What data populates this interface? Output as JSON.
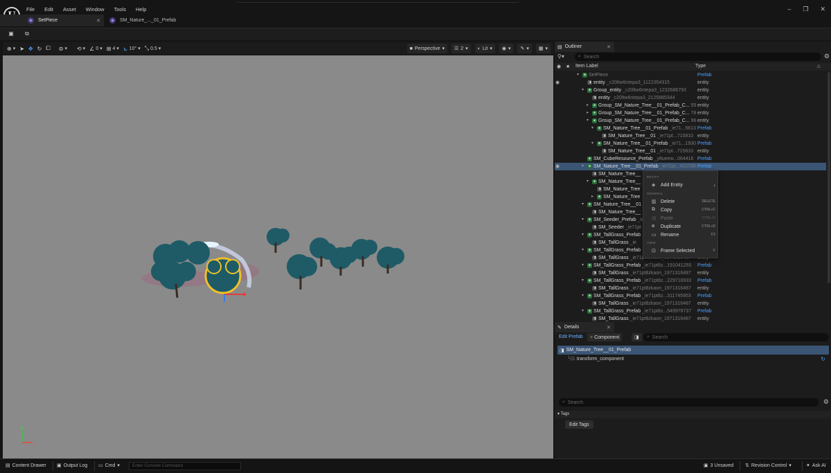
{
  "menu": [
    "File",
    "Edit",
    "Asset",
    "Window",
    "Tools",
    "Help"
  ],
  "tabs": [
    {
      "label": "SetPiece",
      "active": true
    },
    {
      "label": "SM_Nature_..._01_Prefab",
      "active": false
    }
  ],
  "viewport": {
    "num1": "0",
    "num2": "4",
    "angle": "10°",
    "scale": "0.5",
    "perspective": "Perspective",
    "cams": "2",
    "lit": "Lit",
    "axis_up": "U",
    "axis_right": "L"
  },
  "outliner": {
    "title": "Outliner",
    "search_placeholder": "Search",
    "col_label": "Item Label",
    "col_type": "Type",
    "rows": [
      {
        "indent": 0,
        "arrow": "▾",
        "icon": "prefab",
        "label": "SetPiece",
        "sub": "",
        "type": "Prefab",
        "dim": true,
        "eye": false
      },
      {
        "indent": 1,
        "arrow": "",
        "icon": "entity",
        "label": "entity",
        "sub": "_c20ltw6ntepa3_1122354315",
        "type": "entity",
        "eye": true
      },
      {
        "indent": 1,
        "arrow": "▾",
        "icon": "prefab",
        "label": "Group_entity",
        "sub": "_c20ltw6ntepa3_1232686793",
        "type": "entity"
      },
      {
        "indent": 2,
        "arrow": "",
        "icon": "entity",
        "label": "entity",
        "sub": "_c20ltw6ntepa3_2125885344",
        "type": "entity"
      },
      {
        "indent": 2,
        "arrow": "▸",
        "icon": "prefab",
        "label": "Group_SM_Nature_Tree__01_Prefab_C...",
        "sub": "55",
        "type": "entity"
      },
      {
        "indent": 2,
        "arrow": "▸",
        "icon": "prefab",
        "label": "Group_SM_Nature_Tree__01_Prefab_C...",
        "sub": "78",
        "type": "entity"
      },
      {
        "indent": 2,
        "arrow": "▾",
        "icon": "prefab",
        "label": "Group_SM_Nature_Tree__01_Prefab_C...",
        "sub": "96",
        "type": "entity"
      },
      {
        "indent": 3,
        "arrow": "▾",
        "icon": "prefab",
        "label": "SM_Nature_Tree__01_Prefab",
        "sub": "_ie71...5613",
        "type": "Prefab"
      },
      {
        "indent": 4,
        "arrow": "",
        "icon": "entity",
        "label": "SM_Nature_Tree__01",
        "sub": "_ie71pt...715810",
        "type": "entity"
      },
      {
        "indent": 3,
        "arrow": "▾",
        "icon": "prefab",
        "label": "SM_Nature_Tree__01_Prefab",
        "sub": "_ie71...1930",
        "type": "Prefab"
      },
      {
        "indent": 4,
        "arrow": "",
        "icon": "entity",
        "label": "SM_Nature_Tree__01",
        "sub": "_ie71pt...715810",
        "type": "entity"
      },
      {
        "indent": 1,
        "arrow": "",
        "icon": "prefab",
        "label": "SM_CubeResource_Prefab",
        "sub": "_y8ueew...064416",
        "type": "Prefab"
      },
      {
        "indent": 1,
        "arrow": "▾",
        "icon": "prefab",
        "label": "SM_Nature_Tree__01_Prefab",
        "sub": "_ie71pt...410788",
        "type": "Prefab",
        "selected": true,
        "eye": true
      },
      {
        "indent": 2,
        "arrow": "",
        "icon": "entity",
        "label": "SM_Nature_Tree__",
        "sub": "",
        "type": ""
      },
      {
        "indent": 2,
        "arrow": "▾",
        "icon": "prefab",
        "label": "SM_Nature_Tree__",
        "sub": "",
        "type": ""
      },
      {
        "indent": 3,
        "arrow": "",
        "icon": "entity",
        "label": "SM_Nature_Tree",
        "sub": "",
        "type": ""
      },
      {
        "indent": 3,
        "arrow": "▸",
        "icon": "prefab",
        "label": "SM_Nature_Tree",
        "sub": "",
        "type": ""
      },
      {
        "indent": 1,
        "arrow": "▾",
        "icon": "prefab",
        "label": "SM_Nature_Tree__01",
        "sub": "",
        "type": ""
      },
      {
        "indent": 2,
        "arrow": "",
        "icon": "entity",
        "label": "SM_Nature_Tree__",
        "sub": "",
        "type": ""
      },
      {
        "indent": 1,
        "arrow": "▾",
        "icon": "prefab",
        "label": "SM_Seeder_Prefab",
        "sub": "_ie",
        "type": ""
      },
      {
        "indent": 2,
        "arrow": "",
        "icon": "entity",
        "label": "SM_Seeder",
        "sub": "_ie71pt",
        "type": ""
      },
      {
        "indent": 1,
        "arrow": "▾",
        "icon": "prefab",
        "label": "SM_TallGrass_Prefab",
        "sub": "",
        "type": ""
      },
      {
        "indent": 2,
        "arrow": "",
        "icon": "entity",
        "label": "SM_TallGrass",
        "sub": "_ie",
        "type": ""
      },
      {
        "indent": 1,
        "arrow": "▾",
        "icon": "prefab",
        "label": "SM_TallGrass_Prefab",
        "sub": "",
        "type": ""
      },
      {
        "indent": 2,
        "arrow": "",
        "icon": "entity",
        "label": "SM_TallGrass",
        "sub": "_ie71pt8zkaon_1971316487",
        "type": "entity"
      },
      {
        "indent": 1,
        "arrow": "▾",
        "icon": "prefab",
        "label": "SM_TallGrass_Prefab",
        "sub": "_ie71pt8z...191041255",
        "type": "Prefab"
      },
      {
        "indent": 2,
        "arrow": "",
        "icon": "entity",
        "label": "SM_TallGrass",
        "sub": "_ie71pt8zkaon_1971316487",
        "type": "entity"
      },
      {
        "indent": 1,
        "arrow": "▾",
        "icon": "prefab",
        "label": "SM_TallGrass_Prefab",
        "sub": "_ie71pt8z...229716933",
        "type": "Prefab"
      },
      {
        "indent": 2,
        "arrow": "",
        "icon": "entity",
        "label": "SM_TallGrass",
        "sub": "_ie71pt8zkaon_1971316487",
        "type": "entity"
      },
      {
        "indent": 1,
        "arrow": "▾",
        "icon": "prefab",
        "label": "SM_TallGrass_Prefab",
        "sub": "_ie71pt8z...311745953",
        "type": "Prefab"
      },
      {
        "indent": 2,
        "arrow": "",
        "icon": "entity",
        "label": "SM_TallGrass",
        "sub": "_ie71pt8zkaon_1971316487",
        "type": "entity"
      },
      {
        "indent": 1,
        "arrow": "▾",
        "icon": "prefab",
        "label": "SM_TallGrass_Prefab",
        "sub": "_ie71pt8z...549978737",
        "type": "Prefab"
      },
      {
        "indent": 2,
        "arrow": "",
        "icon": "entity",
        "label": "SM_TallGrass",
        "sub": "_ie71pt8zkaon_1971316487",
        "type": "entity"
      }
    ]
  },
  "context_menu": {
    "sec_entity": "ENTITY",
    "add_entity": "Add Entity",
    "sec_general": "GENERAL",
    "delete": "Delete",
    "delete_key": "DELETE",
    "copy": "Copy",
    "copy_key": "CTRL+C",
    "paste": "Paste",
    "paste_key": "CTRL+V",
    "duplicate": "Duplicate",
    "duplicate_key": "CTRL+D",
    "rename": "Rename",
    "rename_key": "F2",
    "sec_view": "VIEW",
    "frame_selected": "Frame Selected",
    "frame_key": "F"
  },
  "details": {
    "title": "Details",
    "edit_prefab": "Edit Prefab",
    "component": "Component",
    "search_placeholder": "Search",
    "entity_name": "SM_Nature_Tree__01_Prefab",
    "component_name": "transform_component",
    "search2_placeholder": "Search",
    "tags_header": "Tags",
    "edit_tags": "Edit Tags"
  },
  "statusbar": {
    "content_drawer": "Content Drawer",
    "output_log": "Output Log",
    "cmd": "Cmd",
    "console_placeholder": "Enter Console Command",
    "unsaved": "3 Unsaved",
    "revision": "Revision Control",
    "ask_ai": "Ask AI"
  },
  "colors": {
    "accent_blue": "#4aa3ff",
    "selection": "#3b5575",
    "viewport_bg": "#8a8a8a",
    "tree_teal": "#1f5f6a"
  }
}
